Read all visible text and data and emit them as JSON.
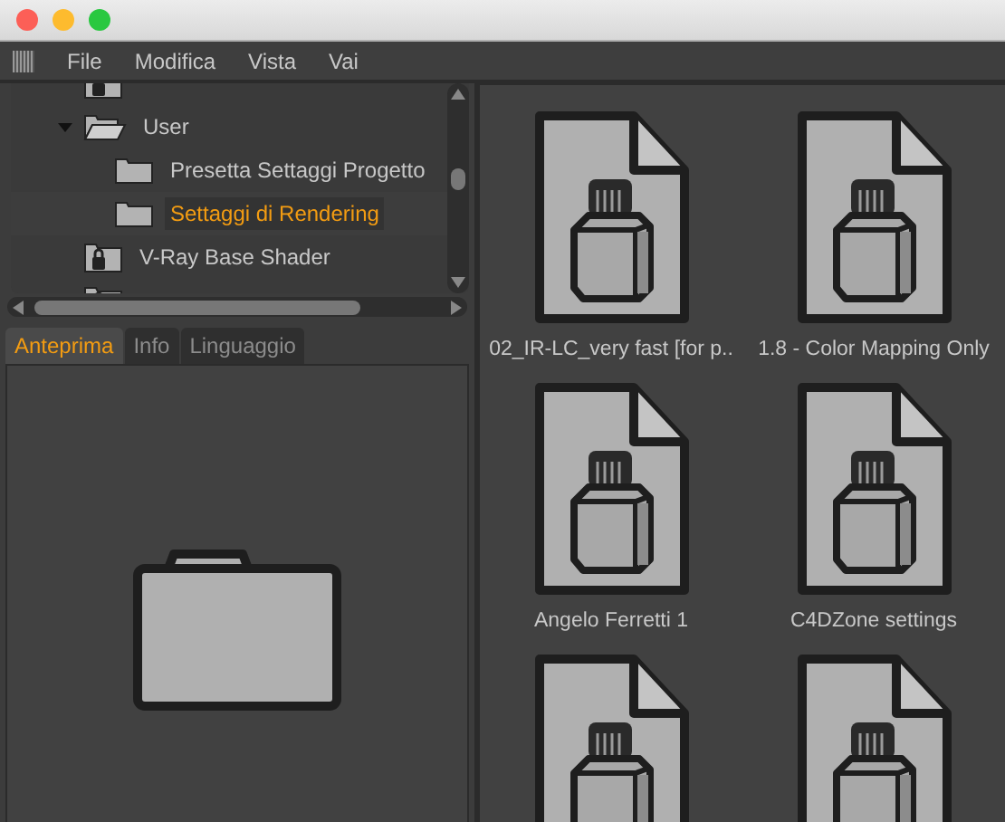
{
  "menu": [
    "File",
    "Modifica",
    "Vista",
    "Vai"
  ],
  "tree": [
    {
      "kind": "library"
    },
    {
      "kind": "folder",
      "label": "User",
      "expanded": true,
      "selected": false,
      "children": [
        {
          "kind": "folder",
          "label": "Presetta Settaggi Progetto",
          "selected": false
        },
        {
          "kind": "folder",
          "label": "Settaggi di Rendering",
          "selected": true
        }
      ]
    },
    {
      "kind": "library",
      "label": "V-Ray Base Shader",
      "selected": false
    },
    {
      "kind": "library"
    }
  ],
  "tabs": [
    {
      "label": "Anteprima",
      "selected": true
    },
    {
      "label": "Info",
      "selected": false
    },
    {
      "label": "Linguaggio",
      "selected": false
    }
  ],
  "files": [
    {
      "label": "02_IR-LC_very fast [for p.."
    },
    {
      "label": "1.8 - Color Mapping Only"
    },
    {
      "label": "Angelo Ferretti 1"
    },
    {
      "label": "C4DZone settings"
    },
    {
      "kind": "document"
    },
    {
      "kind": "document"
    }
  ]
}
